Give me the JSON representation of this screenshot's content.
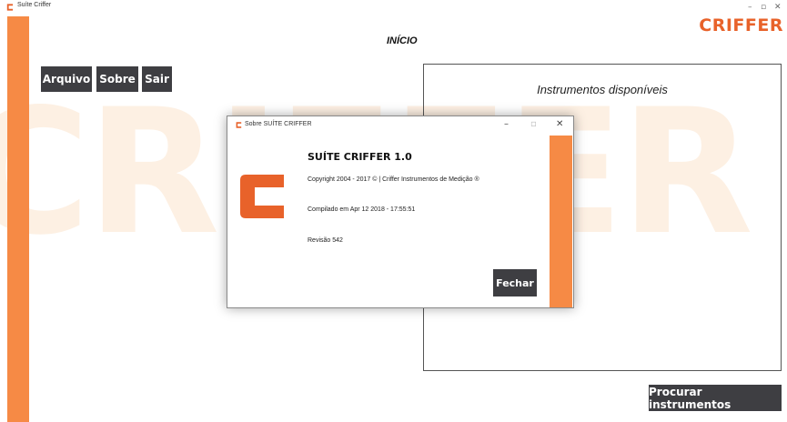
{
  "window": {
    "title": "Suíte Criffer"
  },
  "brand": {
    "logo_text": "CRIFFER",
    "watermark_text": "CRIFFER",
    "accent": "#f68a45",
    "logo_color": "#e8622a"
  },
  "page": {
    "title": "INÍCIO"
  },
  "menu": {
    "arquivo": "Arquivo",
    "sobre": "Sobre",
    "sair": "Sair"
  },
  "instruments": {
    "title": "Instrumentos disponíveis"
  },
  "actions": {
    "search_label": "Procurar instrumentos"
  },
  "about_dialog": {
    "title": "Sobre SUÍTE CRIFFER",
    "product": "SUÍTE CRIFFER 1.0",
    "copyright": "Copyright 2004 - 2017 © | Criffer Instrumentos de Medição ®",
    "compiled": "Compilado em Apr 12 2018 - 17:55:51",
    "revision": "Revisão 542",
    "close_label": "Fechar"
  },
  "icons": {
    "app": "criffer-c-icon",
    "minimize": "minimize-icon",
    "maximize": "maximize-icon",
    "close": "close-icon"
  }
}
